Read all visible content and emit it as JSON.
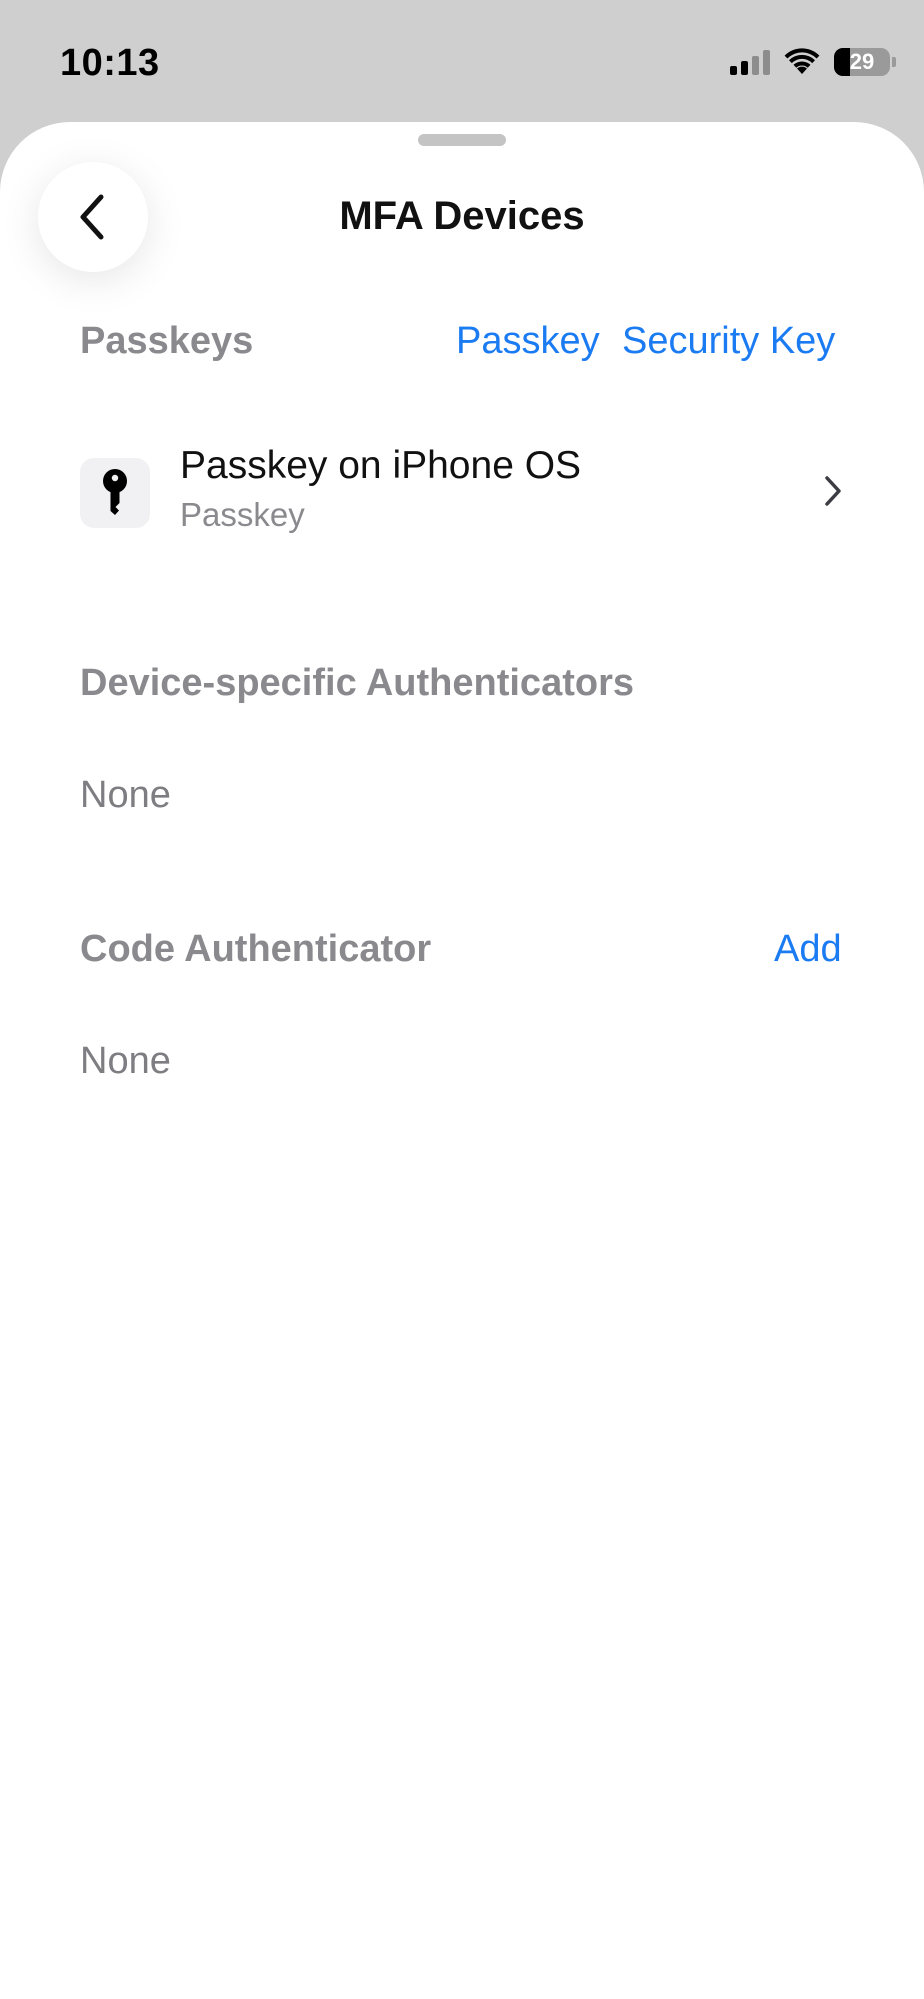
{
  "status_bar": {
    "time": "10:13",
    "battery_percent": "29",
    "battery_level": 0.29,
    "signal_bars_active": 2,
    "signal_bars_total": 4
  },
  "header": {
    "title": "MFA Devices",
    "back_icon": "chevron-left-icon"
  },
  "passkeys": {
    "header": "Passkeys",
    "add_passkey_label": "Passkey",
    "add_security_key_label": "Security Key",
    "items": [
      {
        "title": "Passkey on iPhone OS",
        "subtitle": "Passkey",
        "icon": "key-icon"
      }
    ]
  },
  "device_authenticators": {
    "header": "Device-specific Authenticators",
    "empty_text": "None"
  },
  "code_authenticator": {
    "header": "Code Authenticator",
    "add_label": "Add",
    "empty_text": "None"
  },
  "colors": {
    "accent": "#1a7bf2",
    "secondary_text": "#8a8a8e",
    "background_dim": "#cfcfcf"
  }
}
